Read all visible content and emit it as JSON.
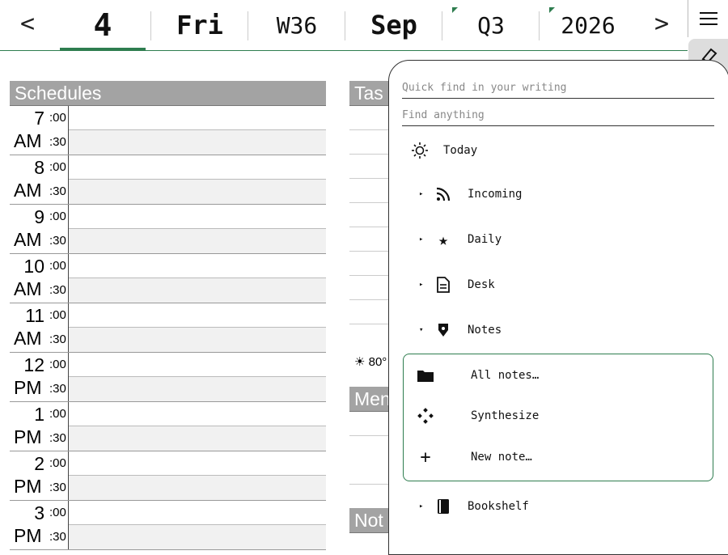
{
  "topbar": {
    "prev": "<",
    "next": ">",
    "day": "4",
    "weekday": "Fri",
    "week": "W36",
    "month": "Sep",
    "quarter": "Q3",
    "year": "2026"
  },
  "schedules": {
    "title": "Schedules",
    "hours": [
      {
        "h": "7",
        "ap": "AM"
      },
      {
        "h": "8",
        "ap": "AM"
      },
      {
        "h": "9",
        "ap": "AM"
      },
      {
        "h": "10",
        "ap": "AM"
      },
      {
        "h": "11",
        "ap": "AM"
      },
      {
        "h": "12",
        "ap": "PM"
      },
      {
        "h": "1",
        "ap": "PM"
      },
      {
        "h": "2",
        "ap": "PM"
      },
      {
        "h": "3",
        "ap": "PM"
      }
    ],
    "m00": ":00",
    "m30": ":30"
  },
  "tasks": {
    "title": "Tas",
    "weather": "☀ 80°",
    "memo_title": "Men",
    "notes_title": "Not"
  },
  "menu": {
    "quick_find_placeholder": "Quick find in your writing",
    "find_anything_placeholder": "Find anything",
    "today": "Today",
    "incoming": "Incoming",
    "daily": "Daily",
    "desk": "Desk",
    "notes": "Notes",
    "all_notes": "All notes…",
    "synthesize": "Synthesize",
    "new_note": "New note…",
    "bookshelf": "Bookshelf"
  },
  "colors": {
    "accent": "#2e7d4f",
    "header_gray": "#a3a3a3"
  }
}
